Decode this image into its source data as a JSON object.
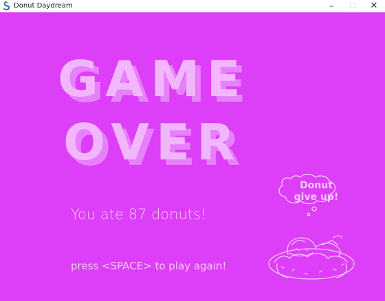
{
  "window": {
    "title": "Donut Daydream",
    "icon": "pygame-snake-icon",
    "controls": {
      "minimize": "–",
      "maximize": "☐",
      "close": "✕"
    }
  },
  "game": {
    "background_color": "#dd3ef7",
    "headline_line1": "GAME",
    "headline_line2": "OVER",
    "headline_color": "#f2b6ff",
    "headline_shadow_color": "#e681fb",
    "score_text": "You ate 87 donuts!",
    "prompt_text": "press <SPACE> to play again!",
    "text_color": "#f6c8ff",
    "bubble_text_line1": "Donut",
    "bubble_text_line2": "give up!",
    "illustration": "sleeping-donut-girl-illustration"
  }
}
